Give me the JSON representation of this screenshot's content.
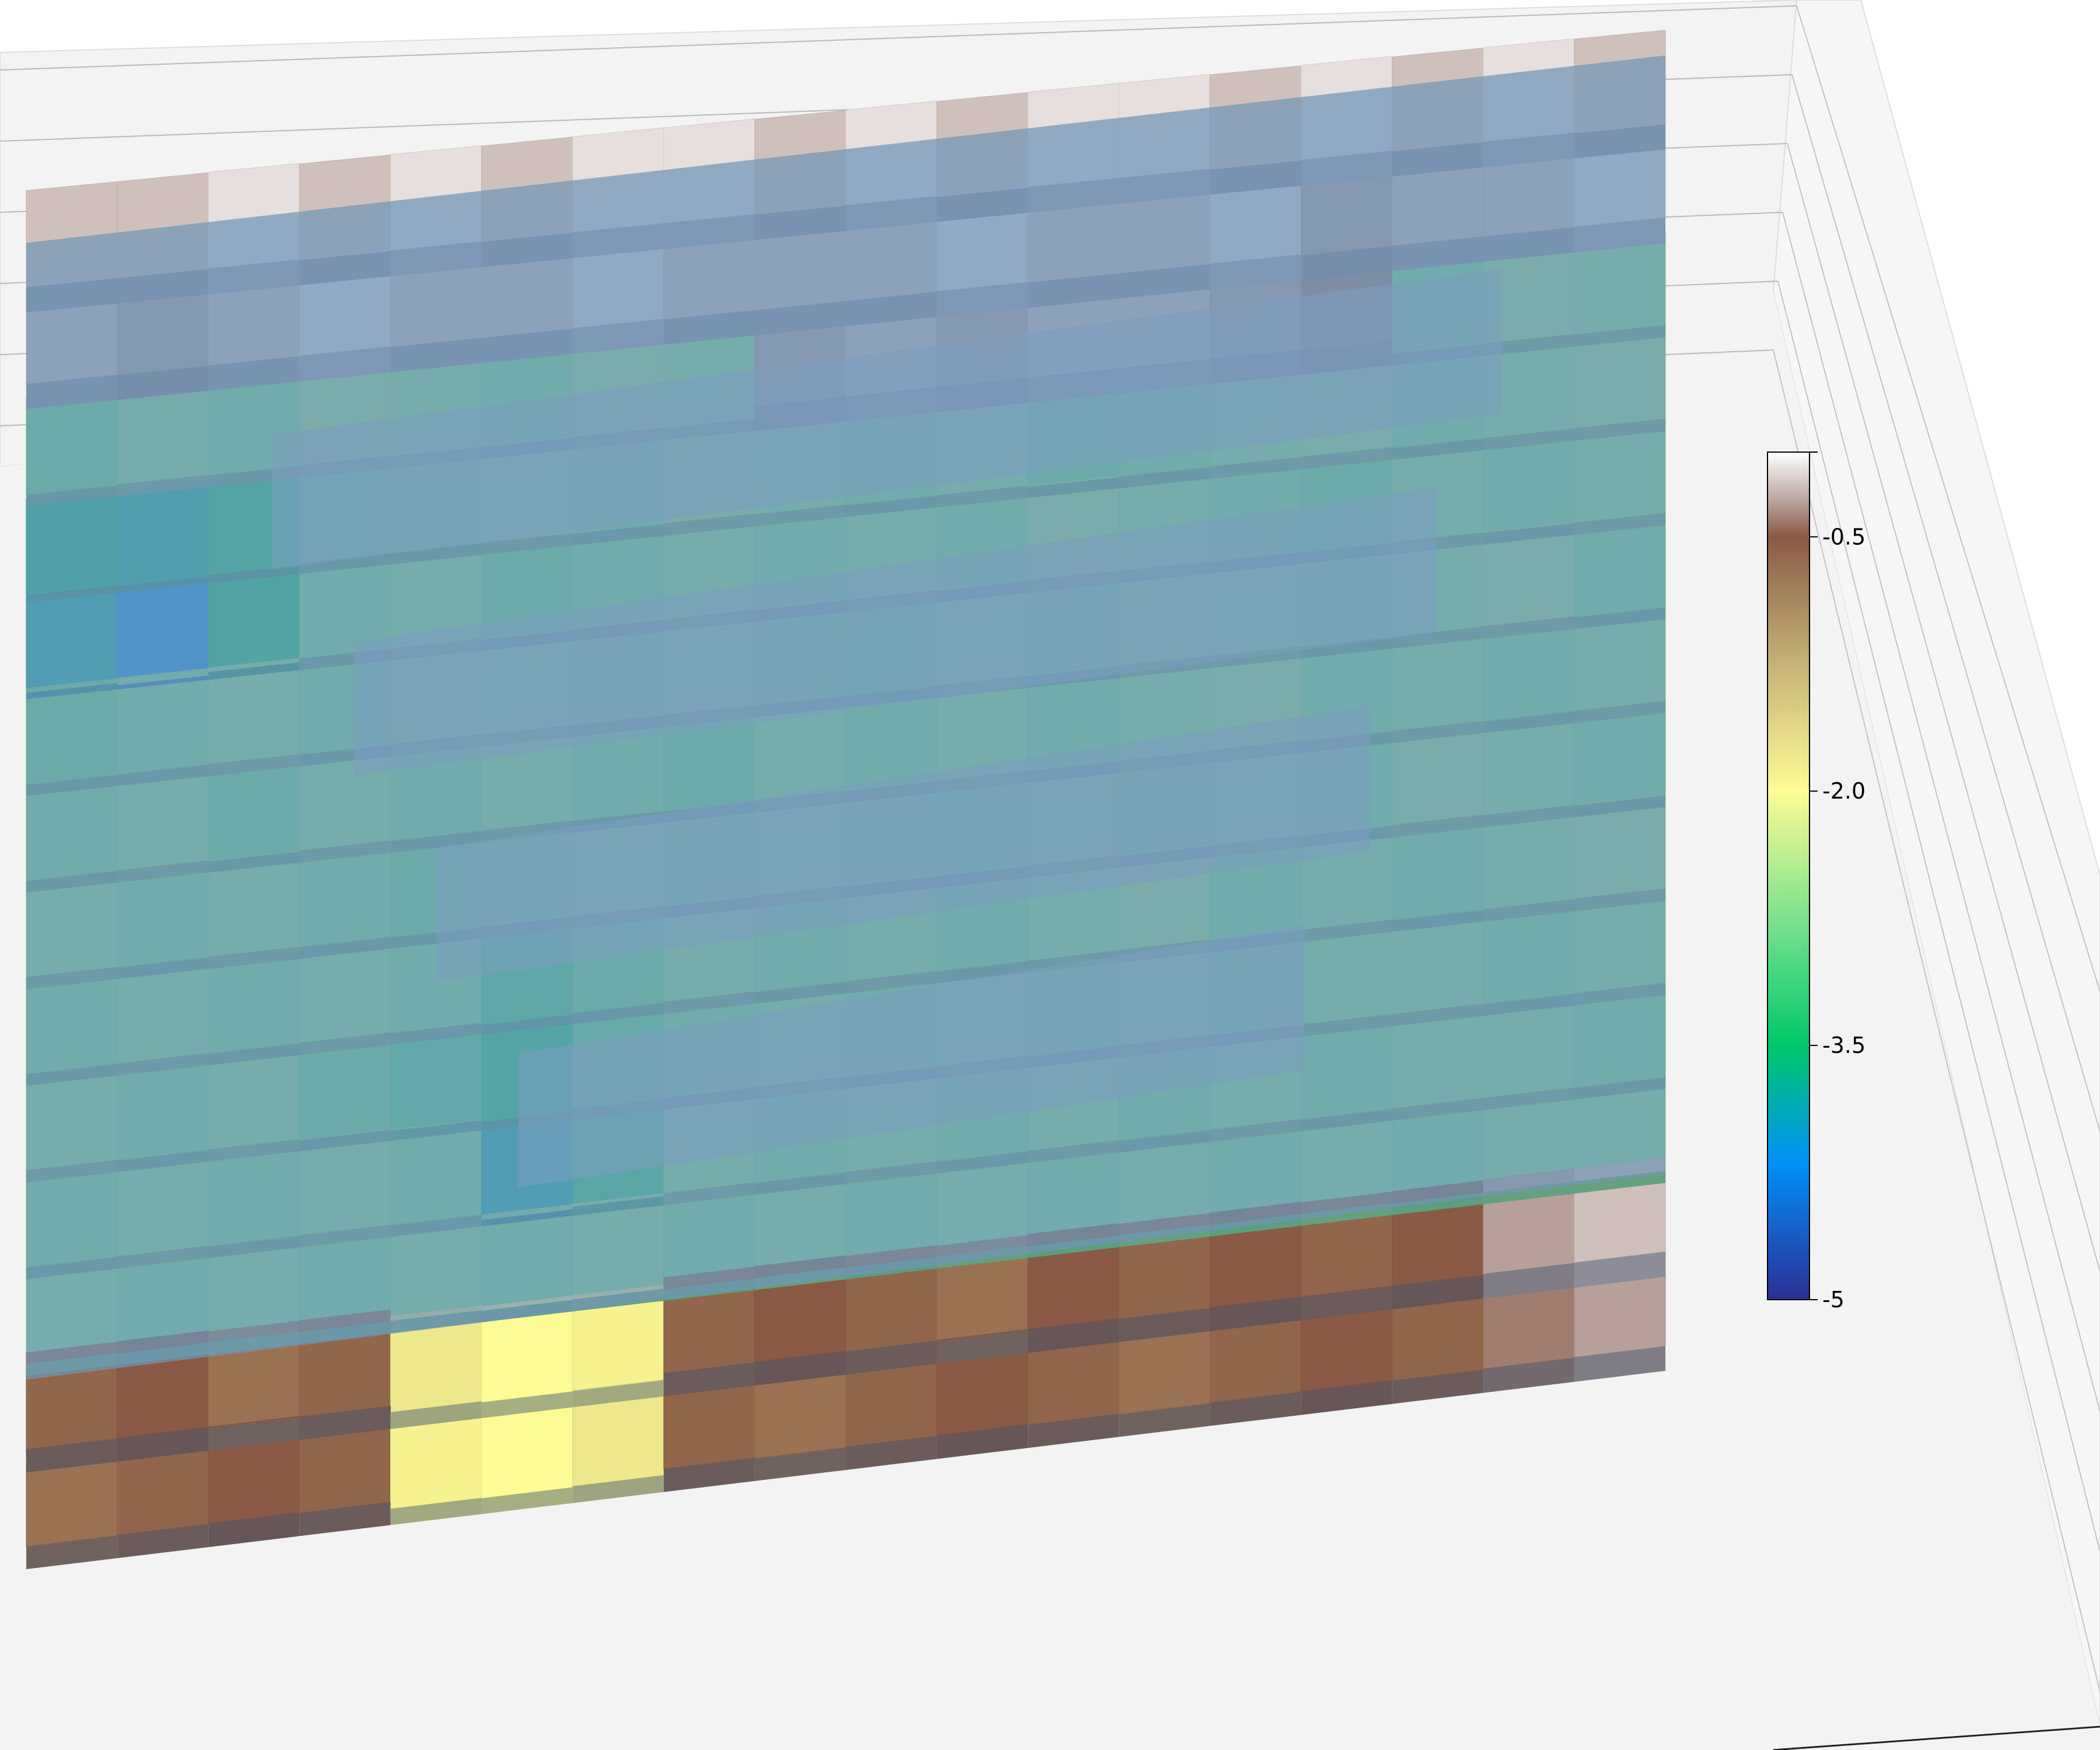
{
  "chart_data": {
    "type": "heatmap",
    "subtype": "3d-voxel-surface",
    "title": "",
    "xlabel": "",
    "ylabel": "",
    "zlabel": "",
    "colormap": "terrain",
    "colorbar": {
      "range": [
        -5,
        0
      ],
      "orientation": "vertical",
      "placement": "right",
      "ticks": [
        {
          "value": 0.0,
          "label": ""
        },
        {
          "value": -0.5,
          "label": "-0.5"
        },
        {
          "value": -2.0,
          "label": "-2.0"
        },
        {
          "value": -3.5,
          "label": "-3.5"
        },
        {
          "value": -5.0,
          "label": "-5"
        }
      ],
      "gradient_stops": [
        {
          "value": 0.0,
          "color": "#ffffff"
        },
        {
          "value": -0.3,
          "color": "#b7a09a"
        },
        {
          "value": -0.5,
          "color": "#8a5a44"
        },
        {
          "value": -1.2,
          "color": "#c2ad75"
        },
        {
          "value": -2.0,
          "color": "#fdfc94"
        },
        {
          "value": -2.8,
          "color": "#74e08c"
        },
        {
          "value": -3.5,
          "color": "#00c86a"
        },
        {
          "value": -4.2,
          "color": "#0090f8"
        },
        {
          "value": -5.0,
          "color": "#2b2f94"
        }
      ]
    },
    "overlay_color": "#7095b9",
    "pane_color": "#f3f3f3",
    "grid": true,
    "rows": 14,
    "cols": 18,
    "values": [
      [
        -0.2,
        -0.2,
        -0.1,
        -0.2,
        -0.1,
        -0.2,
        -0.1,
        -0.1,
        -0.2,
        -0.1,
        -0.2,
        -0.1,
        -0.1,
        -0.2,
        -0.1,
        -0.2,
        -0.1,
        -0.2
      ],
      [
        -0.2,
        -0.3,
        -0.2,
        -0.1,
        -0.2,
        -0.2,
        -0.1,
        -0.2,
        -0.2,
        -0.2,
        -0.1,
        -0.2,
        -0.2,
        -0.1,
        -0.3,
        -0.2,
        -0.2,
        -0.1
      ],
      [
        -2.9,
        -2.7,
        -2.8,
        -2.6,
        -2.7,
        -2.8,
        -2.6,
        -2.7,
        -0.3,
        -0.2,
        -0.3,
        -0.2,
        -0.2,
        -0.3,
        -0.4,
        -2.8,
        -2.6,
        -2.7
      ],
      [
        -3.6,
        -3.7,
        -3.4,
        -2.9,
        -2.8,
        -2.7,
        -2.8,
        -2.6,
        -2.7,
        -2.8,
        -2.7,
        -2.9,
        -2.8,
        -2.7,
        -2.6,
        -2.8,
        -2.7,
        -2.6
      ],
      [
        -3.8,
        -4.2,
        -3.5,
        -2.8,
        -2.7,
        -2.9,
        -2.8,
        -2.7,
        -2.8,
        -2.7,
        -2.8,
        -2.6,
        -2.7,
        -2.8,
        -2.9,
        -2.7,
        -2.8,
        -2.7
      ],
      [
        -2.9,
        -2.8,
        -2.7,
        -2.8,
        -2.6,
        -2.7,
        -2.8,
        -2.7,
        -2.8,
        -2.9,
        -2.7,
        -2.8,
        -2.6,
        -2.7,
        -2.8,
        -2.7,
        -2.6,
        -2.8
      ],
      [
        -2.8,
        -2.7,
        -2.9,
        -2.7,
        -2.8,
        -2.7,
        -2.8,
        -2.9,
        -2.7,
        -2.8,
        -2.7,
        -2.8,
        -2.7,
        -2.6,
        -2.8,
        -2.7,
        -2.8,
        -2.7
      ],
      [
        -2.7,
        -2.8,
        -2.7,
        -2.8,
        -2.9,
        -2.8,
        -2.7,
        -2.8,
        -2.7,
        -2.8,
        -2.8,
        -2.7,
        -2.8,
        -2.7,
        -2.8,
        -2.6,
        -2.7,
        -2.8
      ],
      [
        -2.8,
        -2.7,
        -2.8,
        -2.7,
        -2.8,
        -3.2,
        -2.9,
        -2.7,
        -2.8,
        -2.7,
        -2.8,
        -2.7,
        -2.6,
        -2.8,
        -2.7,
        -2.8,
        -2.7,
        -2.6
      ],
      [
        -2.7,
        -2.8,
        -2.7,
        -2.9,
        -3.1,
        -3.4,
        -3.0,
        -2.8,
        -2.7,
        -2.8,
        -2.7,
        -2.8,
        -2.7,
        -2.8,
        -2.7,
        -2.7,
        -2.8,
        -2.7
      ],
      [
        -2.8,
        -2.7,
        -2.8,
        -2.7,
        -2.8,
        -3.8,
        -3.3,
        -2.7,
        -2.8,
        -2.7,
        -2.8,
        -2.7,
        -2.8,
        -2.7,
        -2.8,
        -2.7,
        -2.7,
        -2.8
      ],
      [
        -2.7,
        -2.8,
        -2.7,
        -2.8,
        -2.7,
        -2.8,
        -2.7,
        -2.8,
        -2.7,
        -2.8,
        -2.7,
        -2.8,
        -2.7,
        -2.8,
        -2.7,
        -2.8,
        -2.7,
        -2.7
      ],
      [
        -0.6,
        -0.5,
        -0.7,
        -0.6,
        -1.8,
        -2.0,
        -1.9,
        -0.6,
        -0.5,
        -0.6,
        -0.7,
        -0.5,
        -0.6,
        -0.5,
        -0.6,
        -0.5,
        -0.3,
        -0.2
      ],
      [
        -0.7,
        -0.6,
        -0.5,
        -0.6,
        -1.9,
        -2.0,
        -1.8,
        -0.6,
        -0.7,
        -0.6,
        -0.5,
        -0.6,
        -0.7,
        -0.6,
        -0.5,
        -0.6,
        -0.4,
        -0.3
      ]
    ]
  }
}
